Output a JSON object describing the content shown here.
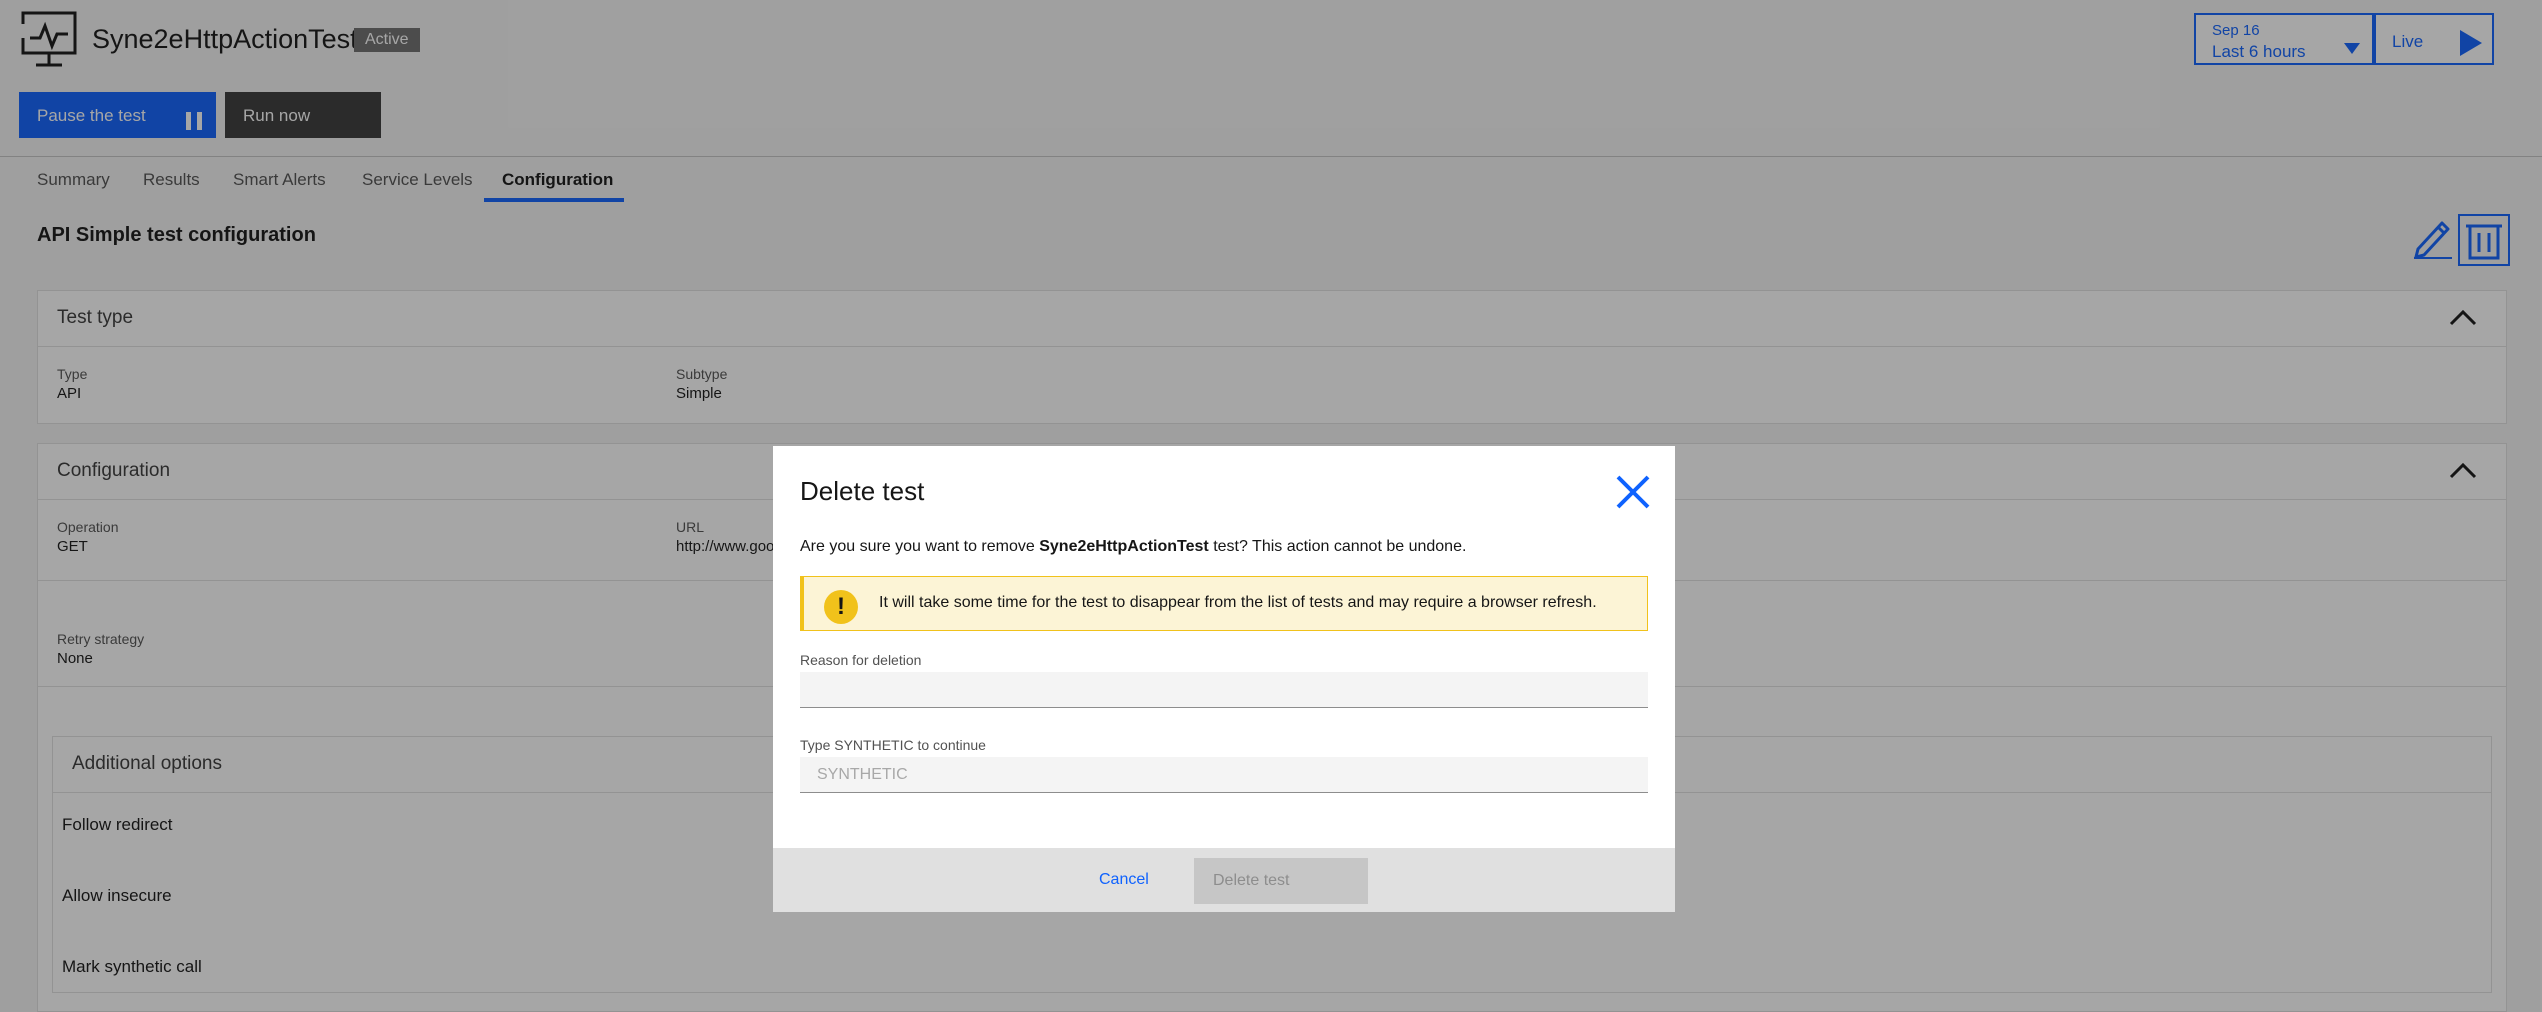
{
  "header": {
    "title": "Syne2eHttpActionTest",
    "status_badge": "Active",
    "time_picker": {
      "date": "Sep 16",
      "range": "Last 6 hours"
    },
    "live_label": "Live"
  },
  "actions": {
    "pause_label": "Pause the test",
    "run_label": "Run now"
  },
  "tabs": [
    {
      "label": "Summary"
    },
    {
      "label": "Results"
    },
    {
      "label": "Smart Alerts"
    },
    {
      "label": "Service Levels"
    },
    {
      "label": "Configuration"
    }
  ],
  "config": {
    "title": "API Simple test configuration",
    "test_type": {
      "heading": "Test type",
      "type_label": "Type",
      "type_value": "API",
      "subtype_label": "Subtype",
      "subtype_value": "Simple"
    },
    "configuration": {
      "heading": "Configuration",
      "operation_label": "Operation",
      "operation_value": "GET",
      "url_label": "URL",
      "url_value": "http://www.goo",
      "retry_label": "Retry strategy",
      "retry_value": "None"
    },
    "additional": {
      "heading": "Additional options",
      "options": [
        "Follow redirect",
        "Allow insecure",
        "Mark synthetic call"
      ]
    }
  },
  "modal": {
    "title": "Delete test",
    "message_prefix": "Are you sure you want to remove ",
    "message_name": "Syne2eHttpActionTest",
    "message_suffix": " test? This action cannot be undone.",
    "warning": "It will take some time for the test to disappear from the list of tests and may require a browser refresh.",
    "reason_label": "Reason for deletion",
    "reason_value": "",
    "confirm_label": "Type SYNTHETIC to continue",
    "confirm_placeholder": "SYNTHETIC",
    "cancel_label": "Cancel",
    "delete_label": "Delete test"
  },
  "colors": {
    "accent": "#0f62fe",
    "warning": "#f1c21b",
    "overlay": "#161616"
  }
}
